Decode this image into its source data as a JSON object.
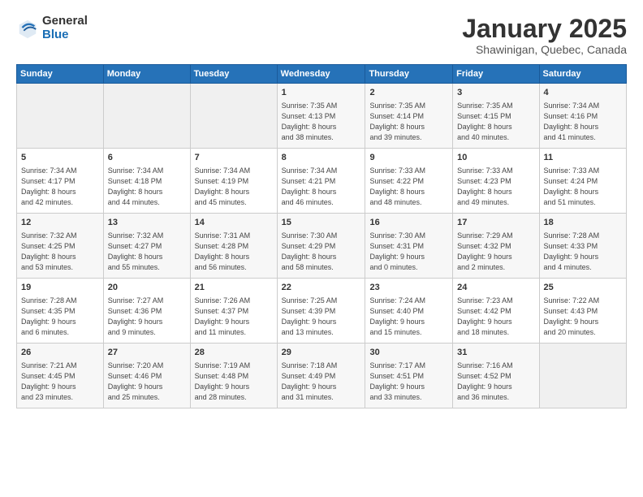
{
  "logo": {
    "line1": "General",
    "line2": "Blue"
  },
  "title": "January 2025",
  "subtitle": "Shawinigan, Quebec, Canada",
  "headers": [
    "Sunday",
    "Monday",
    "Tuesday",
    "Wednesday",
    "Thursday",
    "Friday",
    "Saturday"
  ],
  "weeks": [
    [
      {
        "day": "",
        "info": ""
      },
      {
        "day": "",
        "info": ""
      },
      {
        "day": "",
        "info": ""
      },
      {
        "day": "1",
        "info": "Sunrise: 7:35 AM\nSunset: 4:13 PM\nDaylight: 8 hours\nand 38 minutes."
      },
      {
        "day": "2",
        "info": "Sunrise: 7:35 AM\nSunset: 4:14 PM\nDaylight: 8 hours\nand 39 minutes."
      },
      {
        "day": "3",
        "info": "Sunrise: 7:35 AM\nSunset: 4:15 PM\nDaylight: 8 hours\nand 40 minutes."
      },
      {
        "day": "4",
        "info": "Sunrise: 7:34 AM\nSunset: 4:16 PM\nDaylight: 8 hours\nand 41 minutes."
      }
    ],
    [
      {
        "day": "5",
        "info": "Sunrise: 7:34 AM\nSunset: 4:17 PM\nDaylight: 8 hours\nand 42 minutes."
      },
      {
        "day": "6",
        "info": "Sunrise: 7:34 AM\nSunset: 4:18 PM\nDaylight: 8 hours\nand 44 minutes."
      },
      {
        "day": "7",
        "info": "Sunrise: 7:34 AM\nSunset: 4:19 PM\nDaylight: 8 hours\nand 45 minutes."
      },
      {
        "day": "8",
        "info": "Sunrise: 7:34 AM\nSunset: 4:21 PM\nDaylight: 8 hours\nand 46 minutes."
      },
      {
        "day": "9",
        "info": "Sunrise: 7:33 AM\nSunset: 4:22 PM\nDaylight: 8 hours\nand 48 minutes."
      },
      {
        "day": "10",
        "info": "Sunrise: 7:33 AM\nSunset: 4:23 PM\nDaylight: 8 hours\nand 49 minutes."
      },
      {
        "day": "11",
        "info": "Sunrise: 7:33 AM\nSunset: 4:24 PM\nDaylight: 8 hours\nand 51 minutes."
      }
    ],
    [
      {
        "day": "12",
        "info": "Sunrise: 7:32 AM\nSunset: 4:25 PM\nDaylight: 8 hours\nand 53 minutes."
      },
      {
        "day": "13",
        "info": "Sunrise: 7:32 AM\nSunset: 4:27 PM\nDaylight: 8 hours\nand 55 minutes."
      },
      {
        "day": "14",
        "info": "Sunrise: 7:31 AM\nSunset: 4:28 PM\nDaylight: 8 hours\nand 56 minutes."
      },
      {
        "day": "15",
        "info": "Sunrise: 7:30 AM\nSunset: 4:29 PM\nDaylight: 8 hours\nand 58 minutes."
      },
      {
        "day": "16",
        "info": "Sunrise: 7:30 AM\nSunset: 4:31 PM\nDaylight: 9 hours\nand 0 minutes."
      },
      {
        "day": "17",
        "info": "Sunrise: 7:29 AM\nSunset: 4:32 PM\nDaylight: 9 hours\nand 2 minutes."
      },
      {
        "day": "18",
        "info": "Sunrise: 7:28 AM\nSunset: 4:33 PM\nDaylight: 9 hours\nand 4 minutes."
      }
    ],
    [
      {
        "day": "19",
        "info": "Sunrise: 7:28 AM\nSunset: 4:35 PM\nDaylight: 9 hours\nand 6 minutes."
      },
      {
        "day": "20",
        "info": "Sunrise: 7:27 AM\nSunset: 4:36 PM\nDaylight: 9 hours\nand 9 minutes."
      },
      {
        "day": "21",
        "info": "Sunrise: 7:26 AM\nSunset: 4:37 PM\nDaylight: 9 hours\nand 11 minutes."
      },
      {
        "day": "22",
        "info": "Sunrise: 7:25 AM\nSunset: 4:39 PM\nDaylight: 9 hours\nand 13 minutes."
      },
      {
        "day": "23",
        "info": "Sunrise: 7:24 AM\nSunset: 4:40 PM\nDaylight: 9 hours\nand 15 minutes."
      },
      {
        "day": "24",
        "info": "Sunrise: 7:23 AM\nSunset: 4:42 PM\nDaylight: 9 hours\nand 18 minutes."
      },
      {
        "day": "25",
        "info": "Sunrise: 7:22 AM\nSunset: 4:43 PM\nDaylight: 9 hours\nand 20 minutes."
      }
    ],
    [
      {
        "day": "26",
        "info": "Sunrise: 7:21 AM\nSunset: 4:45 PM\nDaylight: 9 hours\nand 23 minutes."
      },
      {
        "day": "27",
        "info": "Sunrise: 7:20 AM\nSunset: 4:46 PM\nDaylight: 9 hours\nand 25 minutes."
      },
      {
        "day": "28",
        "info": "Sunrise: 7:19 AM\nSunset: 4:48 PM\nDaylight: 9 hours\nand 28 minutes."
      },
      {
        "day": "29",
        "info": "Sunrise: 7:18 AM\nSunset: 4:49 PM\nDaylight: 9 hours\nand 31 minutes."
      },
      {
        "day": "30",
        "info": "Sunrise: 7:17 AM\nSunset: 4:51 PM\nDaylight: 9 hours\nand 33 minutes."
      },
      {
        "day": "31",
        "info": "Sunrise: 7:16 AM\nSunset: 4:52 PM\nDaylight: 9 hours\nand 36 minutes."
      },
      {
        "day": "",
        "info": ""
      }
    ]
  ]
}
